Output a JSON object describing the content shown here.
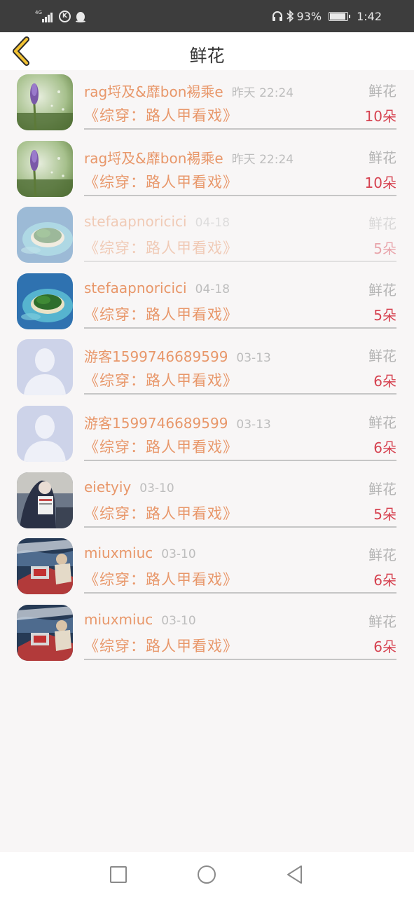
{
  "status_bar": {
    "network": "4G",
    "k_glyph": "K",
    "battery_text": "93%",
    "battery_level": 0.93,
    "time": "1:42"
  },
  "header": {
    "title": "鲜花",
    "back_icon": "chevron-left-icon"
  },
  "records": [
    {
      "username": "rag埒及&靡bon裼乘e",
      "date": "昨天 22:24",
      "gift_type": "鲜花",
      "book": "《综穿：路人甲看戏》",
      "quantity": "10朵",
      "avatar": "lavender-photo"
    },
    {
      "username": "rag埒及&靡bon裼乘e",
      "date": "昨天 22:24",
      "gift_type": "鲜花",
      "book": "《综穿：路人甲看戏》",
      "quantity": "10朵",
      "avatar": "lavender-photo"
    },
    {
      "username": "stefaapnoricici",
      "date": "04-18",
      "gift_type": "鲜花",
      "book": "《综穿：路人甲看戏》",
      "quantity": "5朵",
      "avatar": "island-photo"
    },
    {
      "username": "stefaapnoricici",
      "date": "04-18",
      "gift_type": "鲜花",
      "book": "《综穿：路人甲看戏》",
      "quantity": "5朵",
      "avatar": "island-photo"
    },
    {
      "username": "游客1599746689599",
      "date": "03-13",
      "gift_type": "鲜花",
      "book": "《综穿：路人甲看戏》",
      "quantity": "6朵",
      "avatar": "default-person"
    },
    {
      "username": "游客1599746689599",
      "date": "03-13",
      "gift_type": "鲜花",
      "book": "《综穿：路人甲看戏》",
      "quantity": "6朵",
      "avatar": "default-person"
    },
    {
      "username": "eietyiy",
      "date": "03-10",
      "gift_type": "鲜花",
      "book": "《综穿：路人甲看戏》",
      "quantity": "5朵",
      "avatar": "reading-person-photo"
    },
    {
      "username": "miuxmiuc",
      "date": "03-10",
      "gift_type": "鲜花",
      "book": "《综穿：路人甲看戏》",
      "quantity": "6朵",
      "avatar": "speedboat-photo"
    },
    {
      "username": "miuxmiuc",
      "date": "03-10",
      "gift_type": "鲜花",
      "book": "《综穿：路人甲看戏》",
      "quantity": "6朵",
      "avatar": "speedboat-photo"
    }
  ],
  "nav_bar": {
    "recents_icon": "square-icon",
    "home_icon": "circle-icon",
    "back_icon": "triangle-back-icon"
  },
  "colors": {
    "accent_orange": "#e8976a",
    "quantity_red": "#d64250",
    "back_chevron": "#f2c233",
    "status_bar_bg": "#3d3d3d"
  }
}
